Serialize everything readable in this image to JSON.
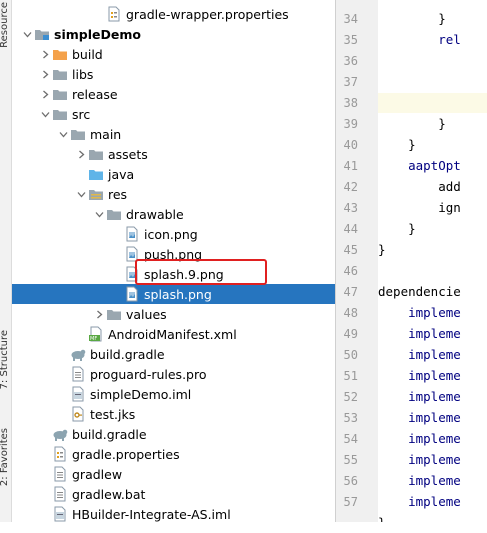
{
  "side_tabs": {
    "resource": "Resource",
    "structure": "7: Structure",
    "favorites": "2: Favorites"
  },
  "tree": [
    {
      "label": "gradle-wrapper.properties",
      "icon": "gradle-properties-icon",
      "depth": 5,
      "arrow": "none"
    },
    {
      "label": "simpleDemo",
      "icon": "module-folder-icon",
      "depth": 1,
      "arrow": "down",
      "bold": true
    },
    {
      "label": "build",
      "icon": "orange-folder-icon",
      "depth": 2,
      "arrow": "right"
    },
    {
      "label": "libs",
      "icon": "gray-folder-icon",
      "depth": 2,
      "arrow": "right"
    },
    {
      "label": "release",
      "icon": "gray-folder-icon",
      "depth": 2,
      "arrow": "right"
    },
    {
      "label": "src",
      "icon": "gray-folder-icon",
      "depth": 2,
      "arrow": "down"
    },
    {
      "label": "main",
      "icon": "gray-folder-icon",
      "depth": 3,
      "arrow": "down"
    },
    {
      "label": "assets",
      "icon": "gray-folder-icon",
      "depth": 4,
      "arrow": "right"
    },
    {
      "label": "java",
      "icon": "blue-folder-icon",
      "depth": 4,
      "arrow": "none"
    },
    {
      "label": "res",
      "icon": "res-folder-icon",
      "depth": 4,
      "arrow": "down"
    },
    {
      "label": "drawable",
      "icon": "gray-folder-icon",
      "depth": 5,
      "arrow": "down"
    },
    {
      "label": "icon.png",
      "icon": "image-file-icon",
      "depth": 6,
      "arrow": "none"
    },
    {
      "label": "push.png",
      "icon": "image-file-icon",
      "depth": 6,
      "arrow": "none"
    },
    {
      "label": "splash.9.png",
      "icon": "image-file-icon",
      "depth": 6,
      "arrow": "none"
    },
    {
      "label": "splash.png",
      "icon": "image-file-icon",
      "depth": 6,
      "arrow": "none",
      "selected": true
    },
    {
      "label": "values",
      "icon": "gray-folder-icon",
      "depth": 5,
      "arrow": "right"
    },
    {
      "label": "AndroidManifest.xml",
      "icon": "manifest-file-icon",
      "depth": 4,
      "arrow": "none"
    },
    {
      "label": "build.gradle",
      "icon": "gradle-elephant-icon",
      "depth": 3,
      "arrow": "none"
    },
    {
      "label": "proguard-rules.pro",
      "icon": "text-file-icon",
      "depth": 3,
      "arrow": "none"
    },
    {
      "label": "simpleDemo.iml",
      "icon": "iml-file-icon",
      "depth": 3,
      "arrow": "none"
    },
    {
      "label": "test.jks",
      "icon": "keystore-file-icon",
      "depth": 3,
      "arrow": "none"
    },
    {
      "label": "build.gradle",
      "icon": "gradle-elephant-icon",
      "depth": 2,
      "arrow": "none"
    },
    {
      "label": "gradle.properties",
      "icon": "gradle-properties-icon",
      "depth": 2,
      "arrow": "none"
    },
    {
      "label": "gradlew",
      "icon": "text-file-icon",
      "depth": 2,
      "arrow": "none"
    },
    {
      "label": "gradlew.bat",
      "icon": "text-file-icon",
      "depth": 2,
      "arrow": "none"
    },
    {
      "label": "HBuilder-Integrate-AS.iml",
      "icon": "iml-file-icon",
      "depth": 2,
      "arrow": "none"
    }
  ],
  "editor": {
    "line_numbers": [
      "34",
      "35",
      "36",
      "37",
      "38",
      "39",
      "40",
      "41",
      "42",
      "43",
      "44",
      "45",
      "46",
      "47",
      "48",
      "49",
      "50",
      "51",
      "52",
      "53",
      "54",
      "55",
      "56",
      "57",
      ""
    ],
    "lines": [
      "        }",
      "        rel",
      "",
      "",
      "",
      "        }",
      "    }",
      "    aaptOpt",
      "        add",
      "        ign",
      "    }",
      "}",
      "",
      "dependencie",
      "    impleme",
      "    impleme",
      "    impleme",
      "    impleme",
      "    impleme",
      "    impleme",
      "    impleme",
      "    impleme",
      "    impleme",
      "    impleme",
      "}"
    ],
    "caret_line_index": 4
  },
  "colors": {
    "selection": "#2675bf",
    "highlight_box": "#e02020",
    "gutter": "#f0f0f0",
    "keyword": "#000080"
  }
}
